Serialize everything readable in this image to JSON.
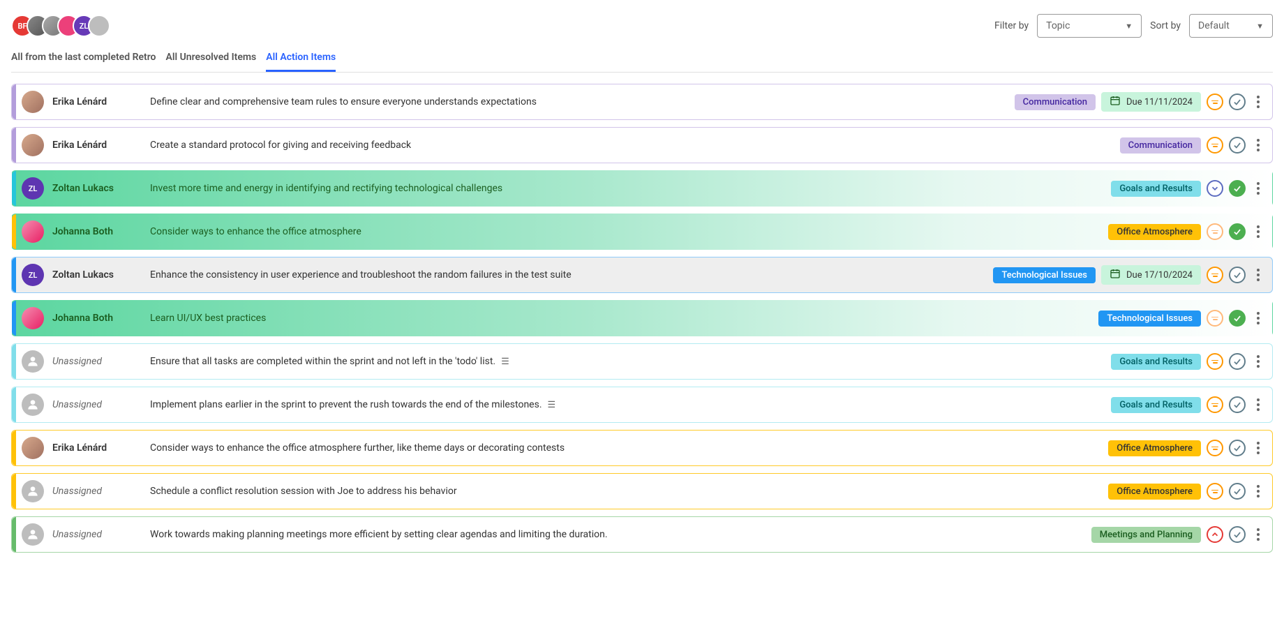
{
  "header": {
    "avatars": [
      {
        "initials": "BF",
        "class": "av-red"
      },
      {
        "initials": "",
        "class": "av-img1"
      },
      {
        "initials": "",
        "class": "av-img2"
      },
      {
        "initials": "",
        "class": "av-pink"
      },
      {
        "initials": "ZL",
        "class": "av-purple"
      },
      {
        "initials": "",
        "class": "av-grey"
      }
    ],
    "filter_label": "Filter by",
    "filter_value": "Topic",
    "sort_label": "Sort by",
    "sort_value": "Default"
  },
  "tabs": [
    {
      "label": "All from the last completed Retro",
      "active": false
    },
    {
      "label": "All Unresolved Items",
      "active": false
    },
    {
      "label": "All Action Items",
      "active": true
    }
  ],
  "items": [
    {
      "border": "border-purple",
      "bg": "",
      "avatar": "av-photo",
      "avatar_initials": "",
      "assignee": "Erika Lénárd",
      "unassigned": false,
      "desc": "Define clear and comprehensive team rules to ensure everyone understands expectations",
      "desc_class": "desc-dark",
      "note": false,
      "tag": "Communication",
      "tag_class": "tag-purple",
      "due": "Due 11/11/2024",
      "priority": "orange",
      "status": "grey-check"
    },
    {
      "border": "border-purple",
      "bg": "",
      "avatar": "av-photo",
      "avatar_initials": "",
      "assignee": "Erika Lénárd",
      "unassigned": false,
      "desc": "Create a standard protocol for giving and receiving feedback",
      "desc_class": "desc-dark",
      "note": false,
      "tag": "Communication",
      "tag_class": "tag-purple",
      "due": "",
      "priority": "orange",
      "status": "grey-check"
    },
    {
      "border": "border-teal",
      "bg": "bg-grad-green",
      "avatar": "av-zl",
      "avatar_initials": "ZL",
      "assignee": "Zoltan Lukacs",
      "unassigned": false,
      "desc": "Invest more time and energy in identifying and rectifying technological challenges",
      "desc_class": "desc-green",
      "note": false,
      "tag": "Goals and Results",
      "tag_class": "tag-teal",
      "due": "",
      "priority": "blue-chev",
      "status": "green-check"
    },
    {
      "border": "border-yellow",
      "bg": "bg-grad-green",
      "avatar": "av-jb",
      "avatar_initials": "",
      "assignee": "Johanna Both",
      "unassigned": false,
      "desc": "Consider ways to enhance the office atmosphere",
      "desc_class": "desc-green",
      "note": false,
      "tag": "Office Atmosphere",
      "tag_class": "tag-yellow",
      "due": "",
      "priority": "orange-light",
      "status": "green-check"
    },
    {
      "border": "border-blue",
      "bg": "bg-grey",
      "avatar": "av-zl",
      "avatar_initials": "ZL",
      "assignee": "Zoltan Lukacs",
      "unassigned": false,
      "desc": "Enhance the consistency in user experience and troubleshoot the random failures in the test suite",
      "desc_class": "desc-dark",
      "note": false,
      "tag": "Technological Issues",
      "tag_class": "tag-blue",
      "due": "Due 17/10/2024",
      "priority": "orange",
      "status": "grey-check"
    },
    {
      "border": "border-blue",
      "bg": "bg-grad-green",
      "avatar": "av-jb",
      "avatar_initials": "",
      "assignee": "Johanna Both",
      "unassigned": false,
      "desc": "Learn UI/UX best practices",
      "desc_class": "desc-green",
      "note": false,
      "tag": "Technological Issues",
      "tag_class": "tag-blue",
      "due": "",
      "priority": "orange-light",
      "status": "green-check"
    },
    {
      "border": "border-teal-light",
      "bg": "",
      "avatar": "av-un",
      "avatar_initials": "",
      "assignee": "Unassigned",
      "unassigned": true,
      "desc": "Ensure that all tasks are completed within the sprint and not left in the 'todo' list.",
      "desc_class": "desc-dark",
      "note": true,
      "tag": "Goals and Results",
      "tag_class": "tag-teal",
      "due": "",
      "priority": "orange",
      "status": "grey-check"
    },
    {
      "border": "border-teal-light",
      "bg": "",
      "avatar": "av-un",
      "avatar_initials": "",
      "assignee": "Unassigned",
      "unassigned": true,
      "desc": "Implement plans earlier in the sprint to prevent the rush towards the end of the milestones.",
      "desc_class": "desc-dark",
      "note": true,
      "tag": "Goals and Results",
      "tag_class": "tag-teal",
      "due": "",
      "priority": "orange",
      "status": "grey-check"
    },
    {
      "border": "border-yellow",
      "bg": "",
      "avatar": "av-photo",
      "avatar_initials": "",
      "assignee": "Erika Lénárd",
      "unassigned": false,
      "desc": "Consider ways to enhance the office atmosphere further, like theme days or decorating contests",
      "desc_class": "desc-dark",
      "note": false,
      "tag": "Office Atmosphere",
      "tag_class": "tag-yellow",
      "due": "",
      "priority": "orange",
      "status": "grey-check"
    },
    {
      "border": "border-yellow",
      "bg": "",
      "avatar": "av-un",
      "avatar_initials": "",
      "assignee": "Unassigned",
      "unassigned": true,
      "desc": "Schedule a conflict resolution session with Joe to address his behavior",
      "desc_class": "desc-dark",
      "note": false,
      "tag": "Office Atmosphere",
      "tag_class": "tag-yellow",
      "due": "",
      "priority": "orange",
      "status": "grey-check"
    },
    {
      "border": "border-green",
      "bg": "",
      "avatar": "av-un",
      "avatar_initials": "",
      "assignee": "Unassigned",
      "unassigned": true,
      "desc": "Work towards making planning meetings more efficient by setting clear agendas and limiting the duration.",
      "desc_class": "desc-dark",
      "note": false,
      "tag": "Meetings and Planning",
      "tag_class": "tag-green",
      "due": "",
      "priority": "red-chev",
      "status": "grey-check"
    }
  ]
}
